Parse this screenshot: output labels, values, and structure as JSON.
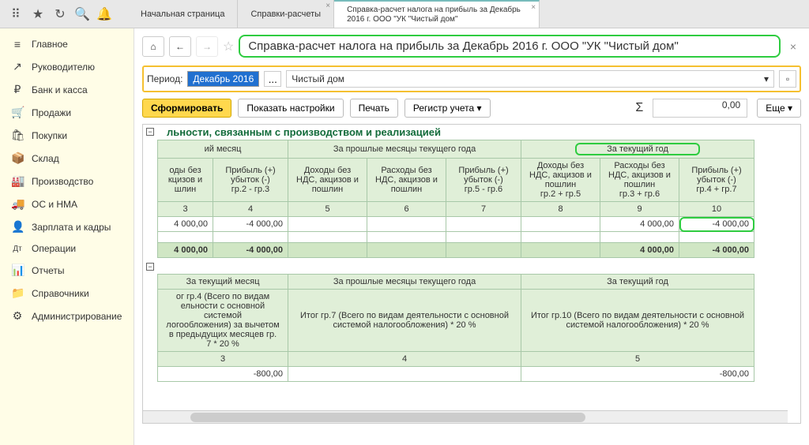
{
  "topbar": {
    "tabs": [
      {
        "label": "Начальная страница"
      },
      {
        "label": "Справки-расчеты"
      },
      {
        "label": "Справка-расчет налога на прибыль  за Декабрь 2016 г. ООО \"УК \"Чистый дом\""
      }
    ]
  },
  "sidebar": [
    {
      "icon": "≡",
      "label": "Главное"
    },
    {
      "icon": "↗",
      "label": "Руководителю"
    },
    {
      "icon": "₽",
      "label": "Банк и касса"
    },
    {
      "icon": "🛒",
      "label": "Продажи"
    },
    {
      "icon": "🛍",
      "label": "Покупки"
    },
    {
      "icon": "📦",
      "label": "Склад"
    },
    {
      "icon": "🏭",
      "label": "Производство"
    },
    {
      "icon": "🚚",
      "label": "ОС и НМА"
    },
    {
      "icon": "👤",
      "label": "Зарплата и кадры"
    },
    {
      "icon": "Дт",
      "label": "Операции"
    },
    {
      "icon": "📊",
      "label": "Отчеты"
    },
    {
      "icon": "📁",
      "label": "Справочники"
    },
    {
      "icon": "⚙",
      "label": "Администрирование"
    }
  ],
  "header": {
    "title": "Справка-расчет налога на прибыль  за Декабрь 2016 г. ООО \"УК \"Чистый дом\""
  },
  "params": {
    "period_label": "Период:",
    "period_value": "Декабрь 2016",
    "org_value": "Чистый дом"
  },
  "actions": {
    "form": "Сформировать",
    "settings": "Показать настройки",
    "print": "Печать",
    "register": "Регистр учета",
    "sum_value": "0,00",
    "more": "Еще"
  },
  "report": {
    "section_title": "льности, связанным с производством и реализацией",
    "t1": {
      "h_month": "ий месяц",
      "h_prev": "За прошлые месяцы текущего года",
      "h_year": "За текущий год",
      "c1": "оды без\nкцизов и\nшлин",
      "c2": "Прибыль (+)\nубыток (-)\nгр.2 - гр.3",
      "c3": "Доходы без\nНДС, акцизов и\nпошлин",
      "c4": "Расходы без\nНДС, акцизов и\nпошлин",
      "c5": "Прибыль (+)\nубыток (-)\nгр.5 - гр.6",
      "c6": "Доходы без\nНДС, акцизов и\nпошлин\nгр.2 + гр.5",
      "c7": "Расходы без\nНДС, акцизов и\nпошлин\nгр.3 + гр.6",
      "c8": "Прибыль (+)\nубыток (-)\nгр.4 + гр.7",
      "nums": [
        "3",
        "4",
        "5",
        "6",
        "7",
        "8",
        "9",
        "10"
      ],
      "row1": {
        "v1": "4 000,00",
        "v2": "-4 000,00",
        "v7": "4 000,00",
        "v8": "-4 000,00"
      },
      "total": {
        "v1": "4 000,00",
        "v2": "-4 000,00",
        "v7": "4 000,00",
        "v8": "-4 000,00"
      }
    },
    "t2": {
      "h_month": "За текущий месяц",
      "h_prev": "За прошлые месяцы текущего года",
      "h_year": "За текущий год",
      "c1": "ог гр.4 (Всего по видам\nельности с основной системой\nлогообложения) за вычетом\nв предыдущих месяцев гр.\n7 * 20 %",
      "c2": "Итог гр.7 (Всего по видам деятельности с основной\nсистемой налогообложения) * 20 %",
      "c3": "Итог гр.10 (Всего по видам деятельности с основной\nсистемой налогообложения) * 20 %",
      "nums": [
        "3",
        "4",
        "5"
      ],
      "row1": {
        "v1": "-800,00",
        "v3": "-800,00"
      }
    }
  }
}
